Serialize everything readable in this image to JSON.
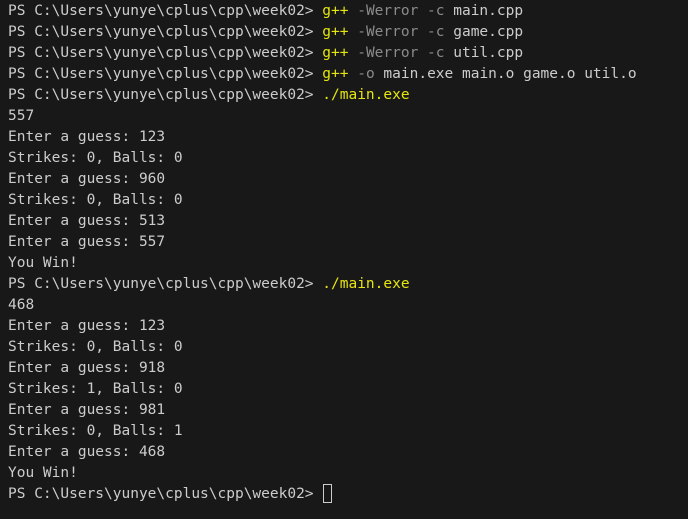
{
  "terminal": {
    "prompt": "PS C:\\Users\\yunye\\cplus\\cpp\\week02> ",
    "colors": {
      "background": "#181818",
      "text": "#cccccc",
      "command": "#e5e510",
      "flag": "#8b8b8b"
    },
    "lines": [
      {
        "kind": "prompt",
        "segments": [
          {
            "text": "g++",
            "style": "cmd"
          },
          {
            "text": " -Werror -c",
            "style": "flag"
          },
          {
            "text": " main.cpp",
            "style": "arg"
          }
        ]
      },
      {
        "kind": "prompt",
        "segments": [
          {
            "text": "g++",
            "style": "cmd"
          },
          {
            "text": " -Werror -c",
            "style": "flag"
          },
          {
            "text": " game.cpp",
            "style": "arg"
          }
        ]
      },
      {
        "kind": "prompt",
        "segments": [
          {
            "text": "g++",
            "style": "cmd"
          },
          {
            "text": " -Werror -c",
            "style": "flag"
          },
          {
            "text": " util.cpp",
            "style": "arg"
          }
        ]
      },
      {
        "kind": "prompt",
        "segments": [
          {
            "text": "g++",
            "style": "cmd"
          },
          {
            "text": " -o",
            "style": "flag"
          },
          {
            "text": " main.exe main.o game.o util.o",
            "style": "arg"
          }
        ]
      },
      {
        "kind": "prompt",
        "segments": [
          {
            "text": "./main.exe",
            "style": "cmd"
          }
        ]
      },
      {
        "kind": "output",
        "text": "557"
      },
      {
        "kind": "output",
        "text": "Enter a guess: 123"
      },
      {
        "kind": "output",
        "text": "Strikes: 0, Balls: 0"
      },
      {
        "kind": "output",
        "text": "Enter a guess: 960"
      },
      {
        "kind": "output",
        "text": "Strikes: 0, Balls: 0"
      },
      {
        "kind": "output",
        "text": "Enter a guess: 513"
      },
      {
        "kind": "output",
        "text": "Enter a guess: 557"
      },
      {
        "kind": "output",
        "text": "You Win!"
      },
      {
        "kind": "prompt",
        "segments": [
          {
            "text": "./main.exe",
            "style": "cmd"
          }
        ]
      },
      {
        "kind": "output",
        "text": "468"
      },
      {
        "kind": "output",
        "text": "Enter a guess: 123"
      },
      {
        "kind": "output",
        "text": "Strikes: 0, Balls: 0"
      },
      {
        "kind": "output",
        "text": "Enter a guess: 918"
      },
      {
        "kind": "output",
        "text": "Strikes: 1, Balls: 0"
      },
      {
        "kind": "output",
        "text": "Enter a guess: 981"
      },
      {
        "kind": "output",
        "text": "Strikes: 0, Balls: 1"
      },
      {
        "kind": "output",
        "text": "Enter a guess: 468"
      },
      {
        "kind": "output",
        "text": "You Win!"
      },
      {
        "kind": "prompt-active",
        "segments": []
      }
    ]
  }
}
